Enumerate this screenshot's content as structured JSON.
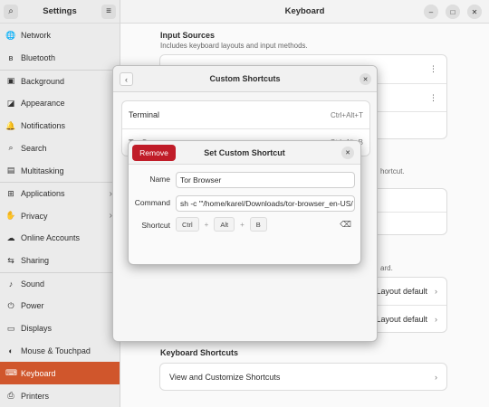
{
  "sidebar": {
    "title": "Settings",
    "items": [
      {
        "label": "Network",
        "icon": "globe-icon",
        "glyph": "🌐"
      },
      {
        "label": "Bluetooth",
        "icon": "bluetooth-icon",
        "glyph": "ʙ"
      },
      {
        "label": "Background",
        "icon": "background-icon",
        "glyph": "▣"
      },
      {
        "label": "Appearance",
        "icon": "appearance-icon",
        "glyph": "◪"
      },
      {
        "label": "Notifications",
        "icon": "bell-icon",
        "glyph": "🔔"
      },
      {
        "label": "Search",
        "icon": "search-icon",
        "glyph": "⌕"
      },
      {
        "label": "Multitasking",
        "icon": "multitasking-icon",
        "glyph": "▤"
      },
      {
        "label": "Applications",
        "icon": "apps-icon",
        "glyph": "⊞"
      },
      {
        "label": "Privacy",
        "icon": "privacy-icon",
        "glyph": "✋"
      },
      {
        "label": "Online Accounts",
        "icon": "cloud-icon",
        "glyph": "☁"
      },
      {
        "label": "Sharing",
        "icon": "share-icon",
        "glyph": "⇆"
      },
      {
        "label": "Sound",
        "icon": "music-icon",
        "glyph": "♪"
      },
      {
        "label": "Power",
        "icon": "power-icon",
        "glyph": "⏻"
      },
      {
        "label": "Displays",
        "icon": "display-icon",
        "glyph": "▭"
      },
      {
        "label": "Mouse & Touchpad",
        "icon": "mouse-icon",
        "glyph": "◐"
      },
      {
        "label": "Keyboard",
        "icon": "keyboard-icon",
        "glyph": "⌨"
      },
      {
        "label": "Printers",
        "icon": "printer-icon",
        "glyph": "⎙"
      }
    ]
  },
  "main": {
    "title": "Keyboard",
    "input_sources_title": "Input Sources",
    "input_sources_sub": "Includes keyboard layouts and input methods.",
    "shortcut_frag": "hortcut.",
    "ard_frag": "ard.",
    "layout_default_1": "Layout default",
    "layout_default_2": "Layout default",
    "keyboard_shortcuts_title": "Keyboard Shortcuts",
    "view_shortcuts": "View and Customize Shortcuts"
  },
  "custom_dialog": {
    "title": "Custom Shortcuts",
    "rows": [
      {
        "name": "Terminal",
        "accel": "Ctrl+Alt+T"
      },
      {
        "name": "Tor Browser",
        "accel": "Ctrl+Alt+B"
      }
    ]
  },
  "set_dialog": {
    "title": "Set Custom Shortcut",
    "remove_label": "Remove",
    "name_label": "Name",
    "name_value": "Tor Browser",
    "command_label": "Command",
    "command_value": "sh -c '\"/home/karel/Downloads/tor-browser_en-US/",
    "shortcut_label": "Shortcut",
    "keys": [
      "Ctrl",
      "Alt",
      "B"
    ]
  },
  "colors": {
    "accent": "#d0562c",
    "destructive": "#c01c28"
  }
}
